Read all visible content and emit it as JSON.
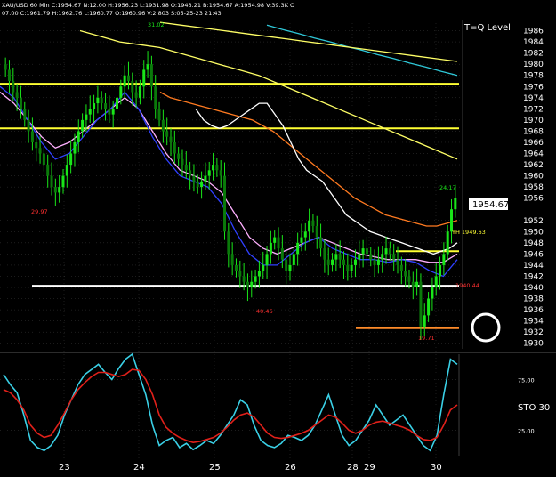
{
  "header": {
    "line1": "XAU/USD 60 Min   C:1954.67  N:12.00  H:1956.23  L:1931.98  O:1943.21  B:1954.67  A:1954.98  V:39.3K  O",
    "line2": "07.00  C:1961.79  H:1962.76  L:1960.77  O:1960.96  V:2,803  S:05-25-23 21:43"
  },
  "annotation": "T=Q Level",
  "colors": {
    "background": "#000000",
    "grid": "#3a3a3a",
    "up_candle": "#19e619",
    "down_candle": "#19e619",
    "price_box": "#ffffff",
    "yellow_levels": "#ffff33",
    "white_level": "#ffffff",
    "orange_level": "#ff8c2a",
    "circle": "#ffffff",
    "sto_k": "#3ad0e6",
    "sto_d": "#e0201a"
  },
  "chart_data": [
    {
      "type": "candlestick",
      "symbol": "XAU/USD",
      "timeframe": "60 Min",
      "ylim": [
        1929,
        1988
      ],
      "y_ticks": [
        1930,
        1932,
        1934,
        1936,
        1938,
        1940,
        1942,
        1944,
        1946,
        1948,
        1950,
        1952,
        1956,
        1958,
        1960,
        1962,
        1964,
        1966,
        1968,
        1970,
        1972,
        1974,
        1976,
        1978,
        1980,
        1982,
        1984,
        1986
      ],
      "x_labels": [
        "23",
        "24",
        "25",
        "26",
        "28",
        "29",
        "30"
      ],
      "last_price": "1954.67",
      "close_series": [
        1979,
        1977,
        1975,
        1974,
        1972,
        1970,
        1968,
        1966,
        1965,
        1964,
        1962,
        1960,
        1958,
        1957,
        1958,
        1960,
        1962,
        1964,
        1966,
        1968,
        1970,
        1971,
        1972,
        1973,
        1974,
        1973,
        1972,
        1971,
        1972,
        1974,
        1976,
        1978,
        1977,
        1975,
        1974,
        1976,
        1979,
        1980,
        1976,
        1972,
        1970,
        1968,
        1967,
        1966,
        1964,
        1963,
        1962,
        1961,
        1960,
        1959,
        1958,
        1959,
        1960,
        1961,
        1962,
        1961,
        1960,
        1950,
        1946,
        1944,
        1943,
        1942,
        1941,
        1940,
        1941,
        1942,
        1943,
        1944,
        1946,
        1948,
        1949,
        1947,
        1945,
        1943,
        1944,
        1946,
        1948,
        1949,
        1950,
        1952,
        1951,
        1949,
        1947,
        1945,
        1944,
        1945,
        1946,
        1945,
        1944,
        1943,
        1944,
        1945,
        1946,
        1947,
        1946,
        1945,
        1944,
        1945,
        1946,
        1947,
        1946,
        1945,
        1944,
        1943,
        1942,
        1941,
        1940,
        1941,
        1933,
        1935,
        1938,
        1940,
        1942,
        1944,
        1946,
        1950,
        1954,
        1956
      ],
      "series": [
        {
          "name": "",
          "color": "#ffff66",
          "values": [
            1986,
            1985,
            1984,
            1983.5,
            1983,
            1982,
            1981,
            1980,
            1979,
            1978,
            1976.5,
            1975,
            1973.5,
            1972,
            1970.5,
            1969,
            1967.5,
            1966,
            1964.5,
            1963
          ]
        },
        {
          "name": "",
          "color": "#2fc8d8",
          "values": [
            1987,
            1986.2,
            1985.5,
            1984.7,
            1984,
            1983.2,
            1982.5,
            1981.7,
            1981,
            1980.2,
            1979.5,
            1978.7,
            1978
          ]
        },
        {
          "name": "",
          "color": "#ffff66",
          "values": [
            1987.5,
            1987,
            1986.5,
            1986,
            1985.5,
            1985,
            1984.5,
            1984,
            1983.5,
            1983,
            1982.5,
            1982,
            1981.5,
            1981,
            1980.5
          ]
        },
        {
          "name": "",
          "color": "#ff7a20",
          "values": [
            1975,
            1974,
            1973.5,
            1973,
            1972.5,
            1972,
            1971.5,
            1971,
            1970.5,
            1970,
            1969,
            1968,
            1966.5,
            1965,
            1963.5,
            1962,
            1960.5,
            1959,
            1957.5,
            1956,
            1955,
            1954,
            1953,
            1952.5,
            1952,
            1951.5,
            1951,
            1951,
            1951.5,
            1952
          ]
        },
        {
          "name": "",
          "color": "#ffffff",
          "values": [
            1972,
            1970,
            1969,
            1968.5,
            1969,
            1970,
            1971,
            1972,
            1973,
            1973,
            1971,
            1969,
            1966,
            1963,
            1961,
            1960,
            1959,
            1957,
            1955,
            1953,
            1952,
            1951,
            1950,
            1949.5,
            1949,
            1948.5,
            1948,
            1947.5,
            1947,
            1946.5,
            1946,
            1946.5,
            1947,
            1948
          ]
        },
        {
          "name": "",
          "color": "#ffb0ff",
          "values": [
            1975,
            1973,
            1970,
            1967,
            1965,
            1966,
            1968,
            1970,
            1972,
            1974,
            1972,
            1968,
            1964,
            1961,
            1960,
            1959,
            1957,
            1953,
            1949,
            1947,
            1946,
            1947,
            1948,
            1949,
            1948,
            1947,
            1946,
            1945.5,
            1945,
            1945,
            1945,
            1944.5,
            1944.5,
            1946
          ]
        },
        {
          "name": "",
          "color": "#3040ff",
          "values": [
            1976,
            1974,
            1970,
            1966,
            1963,
            1964,
            1967,
            1970,
            1972,
            1975,
            1972,
            1967,
            1963,
            1960,
            1959,
            1958,
            1955,
            1950,
            1946,
            1944,
            1944,
            1946,
            1948,
            1949,
            1947,
            1946,
            1945,
            1945,
            1944.5,
            1945,
            1944.5,
            1943,
            1942,
            1945
          ]
        }
      ],
      "levels": [
        {
          "kind": "yellow",
          "value": 1976.5,
          "label": ""
        },
        {
          "kind": "yellow",
          "value": 1968.5,
          "label": ""
        },
        {
          "kind": "yellow",
          "value": 1946.5,
          "label": ""
        },
        {
          "kind": "white",
          "value": 1940.3,
          "label": ""
        },
        {
          "kind": "orange",
          "value": 1932.7,
          "label": ""
        }
      ],
      "data_labels": [
        {
          "text": "31.02"
        },
        {
          "text": "29.97"
        },
        {
          "text": "40.46"
        },
        {
          "text": "19.71"
        },
        {
          "text": "24.17"
        },
        {
          "text": "YH 1949.63"
        },
        {
          "text": "1940.44"
        }
      ]
    },
    {
      "type": "line",
      "name": "STO",
      "ylim": [
        0,
        100
      ],
      "y_ticks": [
        25,
        75
      ],
      "label": "STO  30",
      "series": [
        {
          "name": "",
          "color": "#3ad0e6",
          "values": [
            80,
            70,
            62,
            40,
            15,
            8,
            5,
            10,
            20,
            40,
            55,
            70,
            80,
            85,
            90,
            82,
            75,
            86,
            95,
            100,
            80,
            60,
            30,
            10,
            15,
            18,
            8,
            12,
            6,
            10,
            15,
            12,
            20,
            30,
            40,
            55,
            50,
            30,
            15,
            10,
            8,
            12,
            20,
            18,
            15,
            20,
            30,
            45,
            60,
            40,
            20,
            10,
            15,
            25,
            35,
            50,
            40,
            30,
            35,
            40,
            30,
            20,
            10,
            5,
            20,
            60,
            95,
            90
          ]
        },
        {
          "name": "",
          "color": "#e0201a",
          "values": [
            65,
            62,
            55,
            45,
            30,
            22,
            18,
            20,
            30,
            42,
            55,
            65,
            72,
            78,
            82,
            82,
            80,
            78,
            80,
            85,
            84,
            75,
            60,
            40,
            28,
            22,
            18,
            15,
            13,
            14,
            16,
            18,
            22,
            28,
            35,
            40,
            42,
            38,
            30,
            22,
            18,
            17,
            18,
            20,
            22,
            25,
            30,
            35,
            40,
            38,
            32,
            25,
            22,
            25,
            30,
            33,
            34,
            32,
            30,
            28,
            25,
            20,
            16,
            15,
            18,
            30,
            45,
            50
          ]
        }
      ]
    }
  ]
}
